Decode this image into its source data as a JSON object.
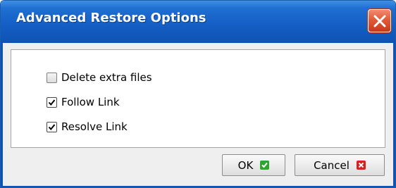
{
  "window": {
    "title": "Advanced Restore Options"
  },
  "options": [
    {
      "label": "Delete extra files",
      "checked": false
    },
    {
      "label": "Follow Link",
      "checked": true
    },
    {
      "label": "Resolve Link",
      "checked": true
    }
  ],
  "buttons": {
    "ok_label": "OK",
    "cancel_label": "Cancel"
  },
  "icons": {
    "close": "close-icon",
    "ok": "check-icon",
    "cancel": "cross-icon"
  },
  "colors": {
    "titlebar": "#155fc6",
    "close_button": "#e05b3a",
    "ok_icon": "#2ea52e",
    "cancel_icon": "#d72020"
  }
}
